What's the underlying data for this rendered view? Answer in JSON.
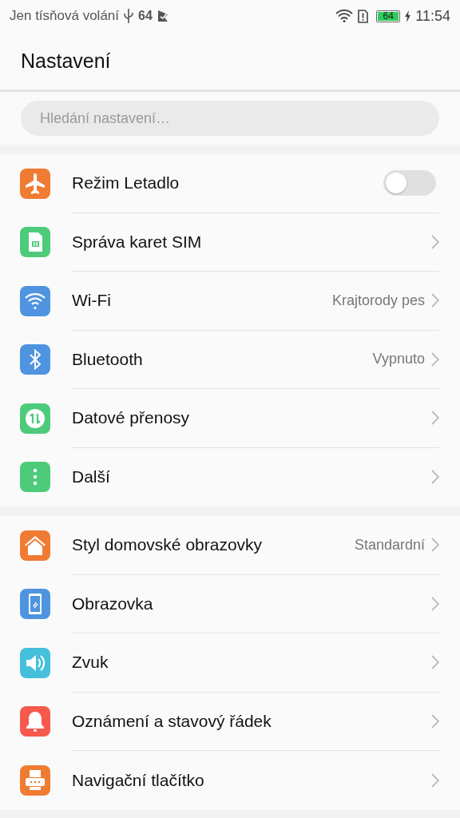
{
  "status_bar": {
    "carrier": "Jen tísňová volání",
    "signal_text": "64",
    "battery_text": "64",
    "time": "11:54"
  },
  "header": {
    "title": "Nastavení"
  },
  "search": {
    "placeholder": "Hledání nastavení…"
  },
  "groups": [
    {
      "items": [
        {
          "kind": "toggle",
          "color": "#f07b32",
          "label": "Režim Letadlo",
          "on": false
        },
        {
          "kind": "link",
          "color": "#4ecb7a",
          "label": "Správa karet SIM"
        },
        {
          "kind": "link",
          "color": "#4f94e0",
          "label": "Wi-Fi",
          "value": "Krajtorody pes"
        },
        {
          "kind": "link",
          "color": "#4f94e0",
          "label": "Bluetooth",
          "value": "Vypnuto"
        },
        {
          "kind": "link",
          "color": "#4ecb7a",
          "label": "Datové přenosy"
        },
        {
          "kind": "link",
          "color": "#4ecb7a",
          "label": "Další"
        }
      ]
    },
    {
      "items": [
        {
          "kind": "link",
          "color": "#f07b32",
          "label": "Styl domovské obrazovky",
          "value": "Standardní"
        },
        {
          "kind": "link",
          "color": "#4f94e0",
          "label": "Obrazovka"
        },
        {
          "kind": "link",
          "color": "#45bfdc",
          "label": "Zvuk"
        },
        {
          "kind": "link",
          "color": "#f75a4c",
          "label": "Oznámení a stavový řádek"
        },
        {
          "kind": "link",
          "color": "#f07b32",
          "label": "Navigační tlačítko"
        }
      ]
    }
  ]
}
